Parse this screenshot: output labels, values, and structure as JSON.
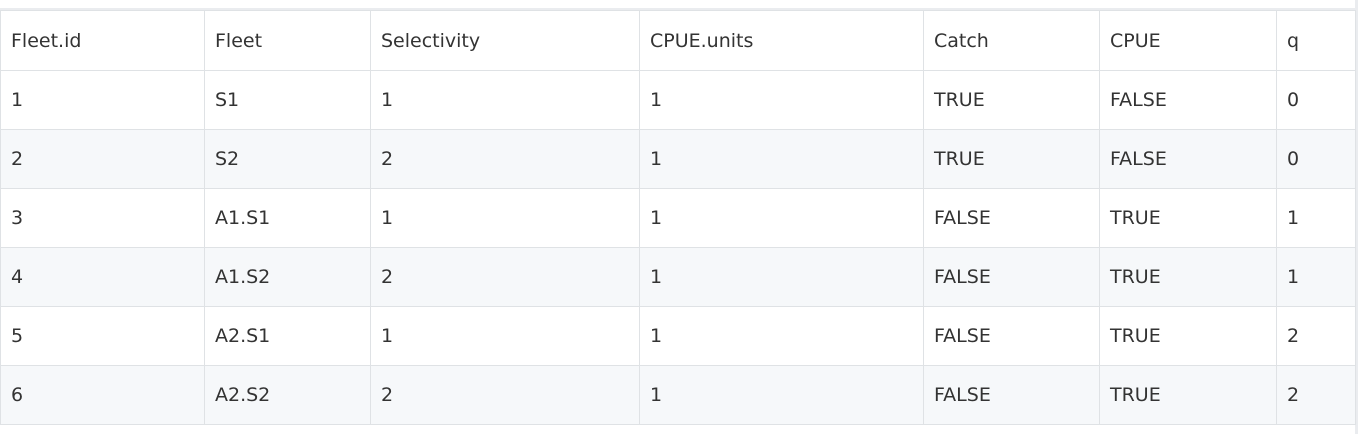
{
  "table": {
    "columns": [
      "Fleet.id",
      "Fleet",
      "Selectivity",
      "CPUE.units",
      "Catch",
      "CPUE",
      "q"
    ],
    "rows": [
      [
        "1",
        "S1",
        "1",
        "1",
        "TRUE",
        "FALSE",
        "0"
      ],
      [
        "2",
        "S2",
        "2",
        "1",
        "TRUE",
        "FALSE",
        "0"
      ],
      [
        "3",
        "A1.S1",
        "1",
        "1",
        "FALSE",
        "TRUE",
        "1"
      ],
      [
        "4",
        "A1.S2",
        "2",
        "1",
        "FALSE",
        "TRUE",
        "1"
      ],
      [
        "5",
        "A2.S1",
        "1",
        "1",
        "FALSE",
        "TRUE",
        "2"
      ],
      [
        "6",
        "A2.S2",
        "2",
        "1",
        "FALSE",
        "TRUE",
        "2"
      ]
    ]
  },
  "colors": {
    "border": "#dfe2e5",
    "stripe": "#f6f8fa",
    "text": "#333333"
  }
}
